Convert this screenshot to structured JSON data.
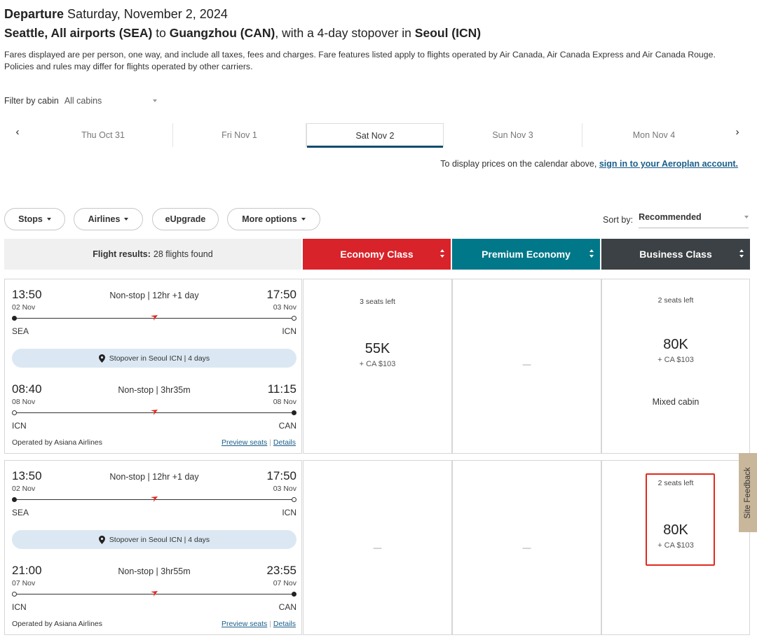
{
  "header": {
    "departure_label": "Departure",
    "departure_date": "Saturday, November 2, 2024",
    "origin": "Seattle, All airports (SEA)",
    "to_word": "to",
    "destination": "Guangzhou (CAN)",
    "stopover_prefix": ", with a 4-day stopover in",
    "stopover_city": "Seoul (ICN)",
    "fare_note": "Fares displayed are per person, one way, and include all taxes, fees and charges. Fare features listed apply to flights operated by Air Canada, Air Canada Express and Air Canada Rouge. Policies and rules may differ for flights operated by other carriers."
  },
  "filter": {
    "label": "Filter by cabin",
    "value": "All cabins"
  },
  "date_tabs": [
    "Thu Oct 31",
    "Fri Nov 1",
    "Sat Nov 2",
    "Sun Nov 3",
    "Mon Nov 4"
  ],
  "date_active_index": 2,
  "calendar_note": {
    "text": "To display prices on the calendar above,",
    "link": "sign in to your Aeroplan account."
  },
  "pills": {
    "stops": "Stops",
    "airlines": "Airlines",
    "eupgrade": "eUpgrade",
    "more": "More options"
  },
  "sort": {
    "label": "Sort by:",
    "value": "Recommended"
  },
  "results": {
    "label": "Flight results:",
    "count": "28 flights found"
  },
  "cabins": [
    {
      "name": "Economy Class",
      "color": "#d8232a"
    },
    {
      "name": "Premium Economy",
      "color": "#00788a"
    },
    {
      "name": "Business Class",
      "color": "#3c4145"
    }
  ],
  "flights": [
    {
      "seg1": {
        "dep_time": "13:50",
        "dep_date": "02 Nov",
        "stops": "Non-stop | 12hr +1 day",
        "arr_time": "17:50",
        "arr_date": "03 Nov",
        "from": "SEA",
        "to": "ICN"
      },
      "stopover": "Stopover in Seoul ICN | 4 days",
      "seg2": {
        "dep_time": "08:40",
        "dep_date": "08 Nov",
        "stops": "Non-stop | 3hr35m",
        "arr_time": "11:15",
        "arr_date": "08 Nov",
        "from": "ICN",
        "to": "CAN"
      },
      "operated_by": "Operated by Asiana Airlines",
      "preview": "Preview seats",
      "sep": "|",
      "details": "Details",
      "economy": {
        "seats": "3 seats left",
        "points": "55K",
        "cash": "+ CA $103"
      },
      "premium": {
        "dash": "—"
      },
      "business": {
        "seats": "2 seats left",
        "points": "80K",
        "cash": "+ CA $103",
        "note": "Mixed cabin"
      }
    },
    {
      "seg1": {
        "dep_time": "13:50",
        "dep_date": "02 Nov",
        "stops": "Non-stop | 12hr +1 day",
        "arr_time": "17:50",
        "arr_date": "03 Nov",
        "from": "SEA",
        "to": "ICN"
      },
      "stopover": "Stopover in Seoul ICN | 4 days",
      "seg2": {
        "dep_time": "21:00",
        "dep_date": "07 Nov",
        "stops": "Non-stop | 3hr55m",
        "arr_time": "23:55",
        "arr_date": "07 Nov",
        "from": "ICN",
        "to": "CAN"
      },
      "operated_by": "Operated by Asiana Airlines",
      "preview": "Preview seats",
      "sep": "|",
      "details": "Details",
      "economy": {
        "dash": "—"
      },
      "premium": {
        "dash": "—"
      },
      "business": {
        "seats": "2 seats left",
        "points": "80K",
        "cash": "+ CA $103"
      }
    }
  ],
  "feedback": "Site Feedback",
  "colors": {
    "link": "#1b5e8a",
    "active_tab_underline": "#0f4c6e",
    "stopover_bg": "#dbe8f3",
    "highlight_box": "#e02a1f",
    "feedback_bg": "#c9b79c"
  }
}
